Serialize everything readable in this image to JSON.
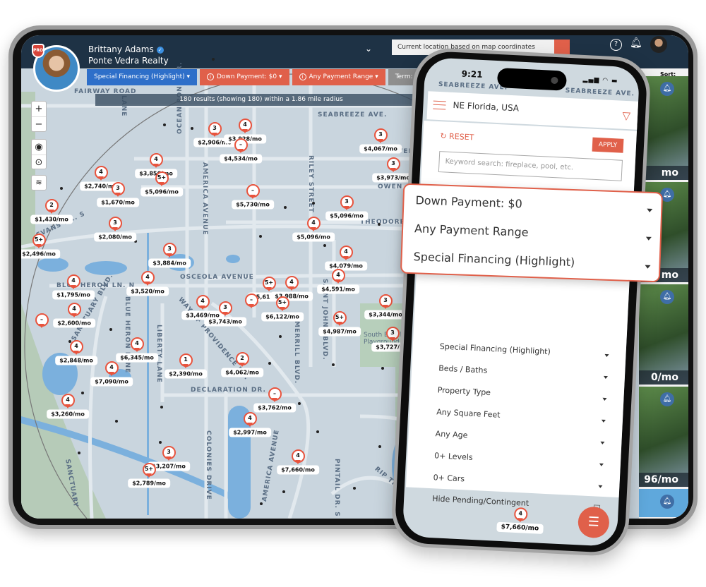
{
  "colors": {
    "accent": "#e0604a",
    "header": "#1e3245",
    "chip_blue": "#2e6fc9",
    "chip_gray": "#8f8f8f"
  },
  "tablet": {
    "agent": {
      "name": "Brittany Adams",
      "company": "Ponte Vedra Realty",
      "badge": "PRO"
    },
    "location_input": "Current location based on map coordinates",
    "chips": [
      {
        "label": "Special Financing (Highlight) ▾",
        "color": "#2e6fc9",
        "icon": ""
      },
      {
        "label": "Down Payment: $0 ▾",
        "color": "#e0604a",
        "icon": "i"
      },
      {
        "label": "Any Payment Range ▾",
        "color": "#e0604a",
        "icon": "i"
      },
      {
        "label": "Term: 30 years",
        "color": "#8f8f8f",
        "icon": ""
      }
    ],
    "results": "180 results (showing 180) within a 1.86 mile radius",
    "sort_label": "Sort:",
    "listing_prices": [
      "mo",
      "mo",
      "0/mo",
      "96/mo"
    ],
    "map_controls": {
      "zoom_in": "+",
      "zoom_out": "−"
    },
    "streets": [
      "FAIRWAY ROAD",
      "SEABREEZE AVE.",
      "RUTH AVENUE",
      "OWEN AVENUE",
      "THEODORE AVENUE",
      "OSCEOLA AVENUE",
      "BLUE HERON LN. N",
      "EVANS DR. S",
      "SANCTUARY BLVD.",
      "BLUE HERON LANE",
      "LIBERTY LANE",
      "WAY OF PROVIDENCE DR.",
      "DECLARATION DR.",
      "MERRILL BLVD.",
      "SAINT JOHNS BLVD.",
      "RILEY STREET",
      "AMERICA AVENUE",
      "OCEAN POND DR.",
      "COLONIES DRIVE",
      "PINTAIL DR. S",
      "RIP TIDE",
      "South Beach and Playground",
      "AMERICA AVENUE",
      "SANCTUARY",
      "LANE"
    ],
    "markers": [
      {
        "count": "3",
        "price": "$2,906/mo"
      },
      {
        "count": "4",
        "price": "$3,928/mo"
      },
      {
        "count": "–",
        "price": "$4,534/mo"
      },
      {
        "count": "4",
        "price": "$3,856/mo"
      },
      {
        "count": "5+",
        "price": "$5,096/mo"
      },
      {
        "count": "4",
        "price": "$2,740/mo"
      },
      {
        "count": "3",
        "price": "$1,670/mo"
      },
      {
        "count": "2",
        "price": "$1,430/mo"
      },
      {
        "count": "3",
        "price": "$2,080/mo"
      },
      {
        "count": "5+",
        "price": "$2,496/mo"
      },
      {
        "count": "3",
        "price": "$3,884/mo"
      },
      {
        "count": "4",
        "price": "$3,520/mo"
      },
      {
        "count": "4",
        "price": "$1,795/mo"
      },
      {
        "count": "–",
        "price": "$5,730/mo"
      },
      {
        "count": "3",
        "price": "$4,067/mo"
      },
      {
        "count": "3",
        "price": "$3,973/mo"
      },
      {
        "count": "3",
        "price": "$5,096/mo"
      },
      {
        "count": "4",
        "price": "$5,096/mo"
      },
      {
        "count": "4",
        "price": "$4,079/mo"
      },
      {
        "count": "4",
        "price": "$4,591/mo"
      },
      {
        "count": "5+",
        "price": "$5,611/mo"
      },
      {
        "count": "4",
        "price": "$3,988/mo"
      },
      {
        "count": "5+",
        "price": "$6,122/mo"
      },
      {
        "count": "–",
        "price": ""
      },
      {
        "count": "4",
        "price": "$3,469/mo"
      },
      {
        "count": "3",
        "price": "$3,743/mo"
      },
      {
        "count": "3",
        "price": "$3,344/mo"
      },
      {
        "count": "5+",
        "price": "$4,987/mo"
      },
      {
        "count": "3",
        "price": "$3,727/mo"
      },
      {
        "count": "–",
        "price": ""
      },
      {
        "count": "4",
        "price": "$2,600/mo"
      },
      {
        "count": "4",
        "price": "$2,848/mo"
      },
      {
        "count": "4",
        "price": "$6,345/mo"
      },
      {
        "count": "4",
        "price": "$7,090/mo"
      },
      {
        "count": "1",
        "price": "$2,390/mo"
      },
      {
        "count": "2",
        "price": "$4,062/mo"
      },
      {
        "count": "4",
        "price": "$3,260/mo"
      },
      {
        "count": "–",
        "price": "$3,762/mo"
      },
      {
        "count": "4",
        "price": "$2,997/mo"
      },
      {
        "count": "3",
        "price": "$3,207/mo"
      },
      {
        "count": "5+",
        "price": "$2,789/mo"
      },
      {
        "count": "4",
        "price": "$7,660/mo"
      }
    ]
  },
  "phone": {
    "time": "9:21",
    "status": "▂▄▆ ◠ ▬",
    "street": "SEABREEZE AVE.",
    "location": "NE Florida, USA",
    "reset": "RESET",
    "apply": "APPLY",
    "keyword_placeholder": "Keyword search: fireplace, pool, etc.",
    "options": [
      "Special Financing (Highlight)",
      "Beds / Baths",
      "Property Type",
      "Any Square Feet",
      "Any Age",
      "0+ Levels",
      "0+ Cars"
    ],
    "hide_pending": "Hide Pending/Contingent",
    "hide_pending_checked": false,
    "marker": {
      "count": "4",
      "price": "$7,660/mo"
    }
  },
  "popup": {
    "options": [
      "Down Payment: $0",
      "Any Payment Range",
      "Special Financing (Highlight)"
    ]
  }
}
